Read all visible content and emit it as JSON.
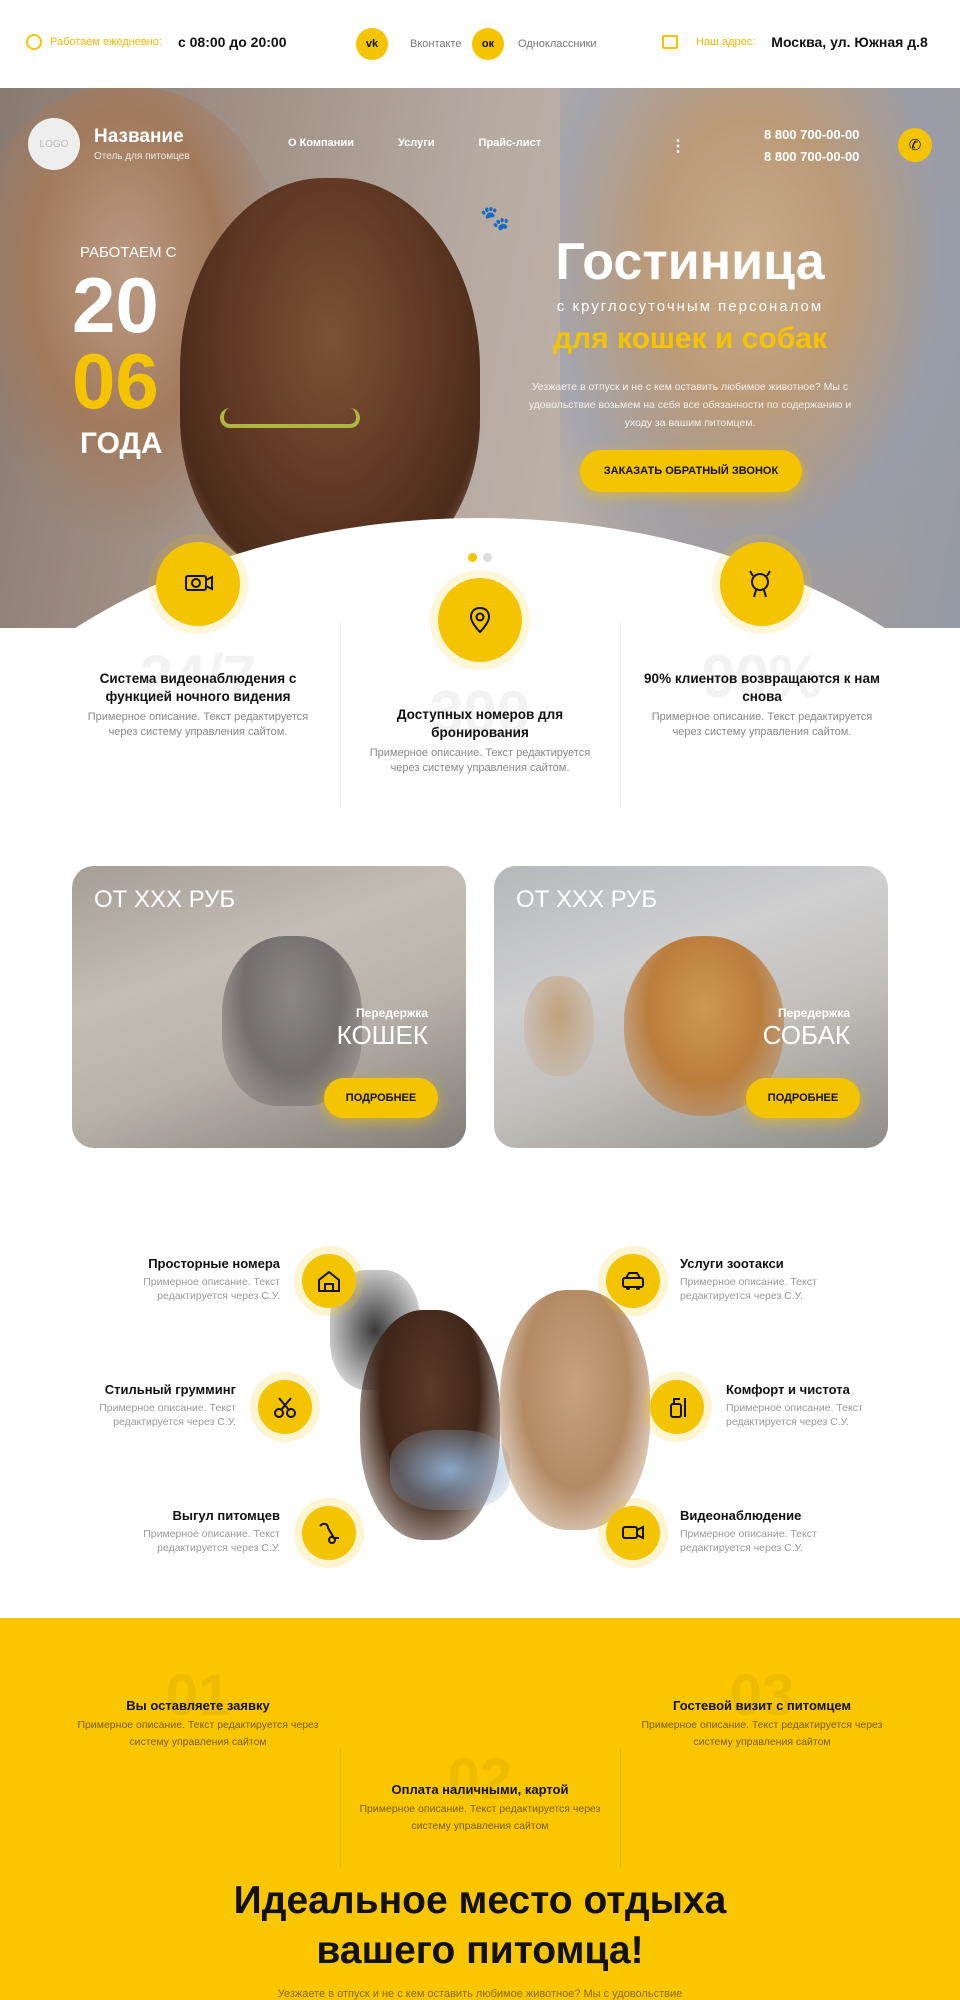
{
  "topbar": {
    "hours_label": "Работаем ежедневно:",
    "hours_value": "с 08:00 до 20:00",
    "vk_icon_text": "vk",
    "vk_label": "Вконтакте",
    "ok_icon_text": "ок",
    "ok_label": "Одноклассники",
    "address_label": "Наш адрес:",
    "address_value": "Москва, ул. Южная д.8"
  },
  "header": {
    "logo_text": "LOGO",
    "brand_name": "Название",
    "brand_sub": "Отель для питомцев",
    "nav": [
      "О Компании",
      "Услуги",
      "Прайс-лист"
    ],
    "more": "⋮",
    "phone1": "8 800 700-00-00",
    "phone2": "8 800 700-00-00"
  },
  "hero": {
    "since_label": "РАБОТАЕМ С",
    "year_part1": "20",
    "year_part2": "06",
    "since_suffix": "ГОДА",
    "title": "Гостиница",
    "subtitle": "с круглосуточным персоналом",
    "subtitle2": "для кошек и собак",
    "description": "Уезжаете в отпуск и не с кем оставить любимое животное? Мы с удовольствие возьмем на себя все обязанности по содержанию и уходу за вашим питомцем.",
    "button": "ЗАКАЗАТЬ ОБРАТНЫЙ ЗВОНОК",
    "slide_count": 2,
    "active_slide": 1
  },
  "features": [
    {
      "bg_text": "24/7",
      "title": "Система видеонаблюдения с функцией ночного видения",
      "desc": "Примерное описание. Текст редактируется через систему управления сайтом."
    },
    {
      "bg_text": "300",
      "title": "Доступных номеров для бронирования",
      "desc": "Примерное описание. Текст редактируется через систему управления сайтом."
    },
    {
      "bg_text": "90%",
      "title": "90% клиентов возвращаются к нам снова",
      "desc": "Примерное описание. Текст редактируется через систему управления сайтом."
    }
  ],
  "cards": [
    {
      "price": "ОТ XXX РУБ",
      "kicker": "Передержка",
      "title": "КОШЕК",
      "button": "ПОДРОБНЕЕ"
    },
    {
      "price": "ОТ XXX РУБ",
      "kicker": "Передержка",
      "title": "СОБАК",
      "button": "ПОДРОБНЕЕ"
    }
  ],
  "services": {
    "left": [
      {
        "title": "Просторные номера",
        "desc": "Примерное описание. Текст редактируется через С.У."
      },
      {
        "title": "Стильный грумминг",
        "desc": "Примерное описание. Текст редактируется через С.У."
      },
      {
        "title": "Выгул питомцев",
        "desc": "Примерное описание. Текст редактируется через С.У."
      }
    ],
    "right": [
      {
        "title": "Услуги зоотакси",
        "desc": "Примерное описание. Текст редактируется через С.У."
      },
      {
        "title": "Комфорт и чистота",
        "desc": "Примерное описание. Текст редактируется через С.У."
      },
      {
        "title": "Видеонаблюдение",
        "desc": "Примерное описание. Текст редактируется через С.У."
      }
    ]
  },
  "steps": [
    {
      "bg_text": "01",
      "title": "Вы оставляете заявку",
      "desc": "Примерное описание. Текст редактируется через систему управления сайтом"
    },
    {
      "bg_text": "02",
      "title": "Оплата наличными, картой",
      "desc": "Примерное описание. Текст редактируется через систему управления сайтом"
    },
    {
      "bg_text": "03",
      "title": "Гостевой визит с питомцем",
      "desc": "Примерное описание. Текст редактируется через систему управления сайтом"
    }
  ],
  "bottom": {
    "title_line1": "Идеальное место отдыха",
    "title_line2": "вашего питомца!",
    "desc": "Уезжаете в отпуск и не с кем оставить любимое животное? Мы с удовольствие"
  },
  "colors": {
    "accent": "#f5c400",
    "accent_section": "#fac600",
    "text": "#111111",
    "muted": "#888888"
  },
  "icons": [
    "clock-icon",
    "vk-icon",
    "odnoklassniki-icon",
    "map-icon",
    "phone-icon",
    "paw-icon",
    "camera-icon",
    "location-pin-icon",
    "dog-icon",
    "doghouse-icon",
    "scissors-icon",
    "leash-icon",
    "pet-taxi-icon",
    "cleaning-icon",
    "video-icon"
  ]
}
